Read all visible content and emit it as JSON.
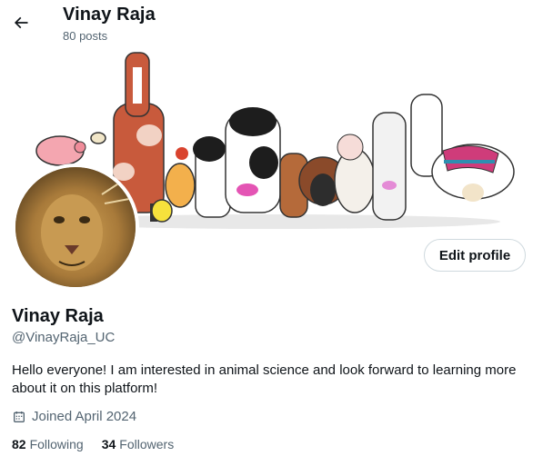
{
  "header": {
    "back_icon": "arrow-left-icon",
    "title": "Vinay Raja",
    "post_count": "80 posts"
  },
  "banner": {
    "description_icon": "farm-animals-illustration"
  },
  "avatar": {
    "icon": "lion-photo"
  },
  "actions": {
    "edit_profile_label": "Edit profile"
  },
  "profile": {
    "name": "Vinay Raja",
    "handle": "@VinayRaja_UC",
    "bio": "Hello everyone! I am interested in animal science and look forward to learning more about it on this platform!",
    "joined_icon": "calendar-icon",
    "joined": "Joined April 2024",
    "following_count": "82",
    "following_label": "Following",
    "followers_count": "34",
    "followers_label": "Followers"
  },
  "colors": {
    "text_primary": "#0f1419",
    "text_secondary": "#536471",
    "border": "#cfd9de",
    "background": "#ffffff"
  }
}
